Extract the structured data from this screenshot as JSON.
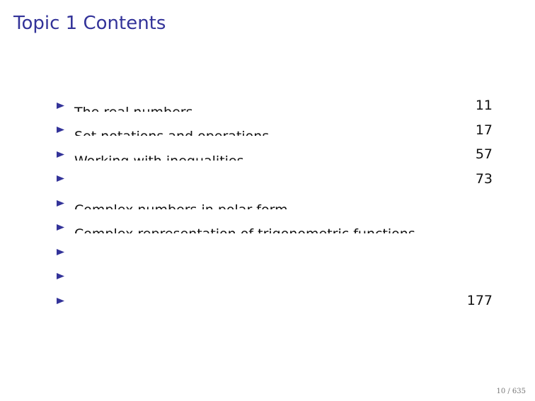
{
  "slide": {
    "title": "Topic 1 Contents",
    "page_number": "10 / 635"
  },
  "toc": {
    "entries": [
      {
        "title": "The real numbers",
        "page": "11",
        "title_visible": "partial",
        "page_visible": true
      },
      {
        "title": "Set notations and operations",
        "page": "17",
        "title_visible": "partial",
        "page_visible": true
      },
      {
        "title": "Working with inequalities",
        "page": "57",
        "title_visible": "partial-top",
        "page_visible": true
      },
      {
        "title": "",
        "page": "73",
        "title_visible": "hidden",
        "page_visible": true
      },
      {
        "title": "Complex numbers in polar form",
        "page": "",
        "title_visible": "partial",
        "page_visible": false
      },
      {
        "title": "Complex representation of trigonometric functions",
        "page": "",
        "title_visible": "partial-top",
        "page_visible": false
      },
      {
        "title": "",
        "page": "",
        "title_visible": "hidden",
        "page_visible": false
      },
      {
        "title": "",
        "page": "",
        "title_visible": "hidden",
        "page_visible": false
      },
      {
        "title": "",
        "page": "177",
        "title_visible": "hidden",
        "page_visible": true
      }
    ],
    "bullet_color": "#333399"
  },
  "colors": {
    "title": "#333399",
    "text": "#111111",
    "background": "#ffffff"
  }
}
